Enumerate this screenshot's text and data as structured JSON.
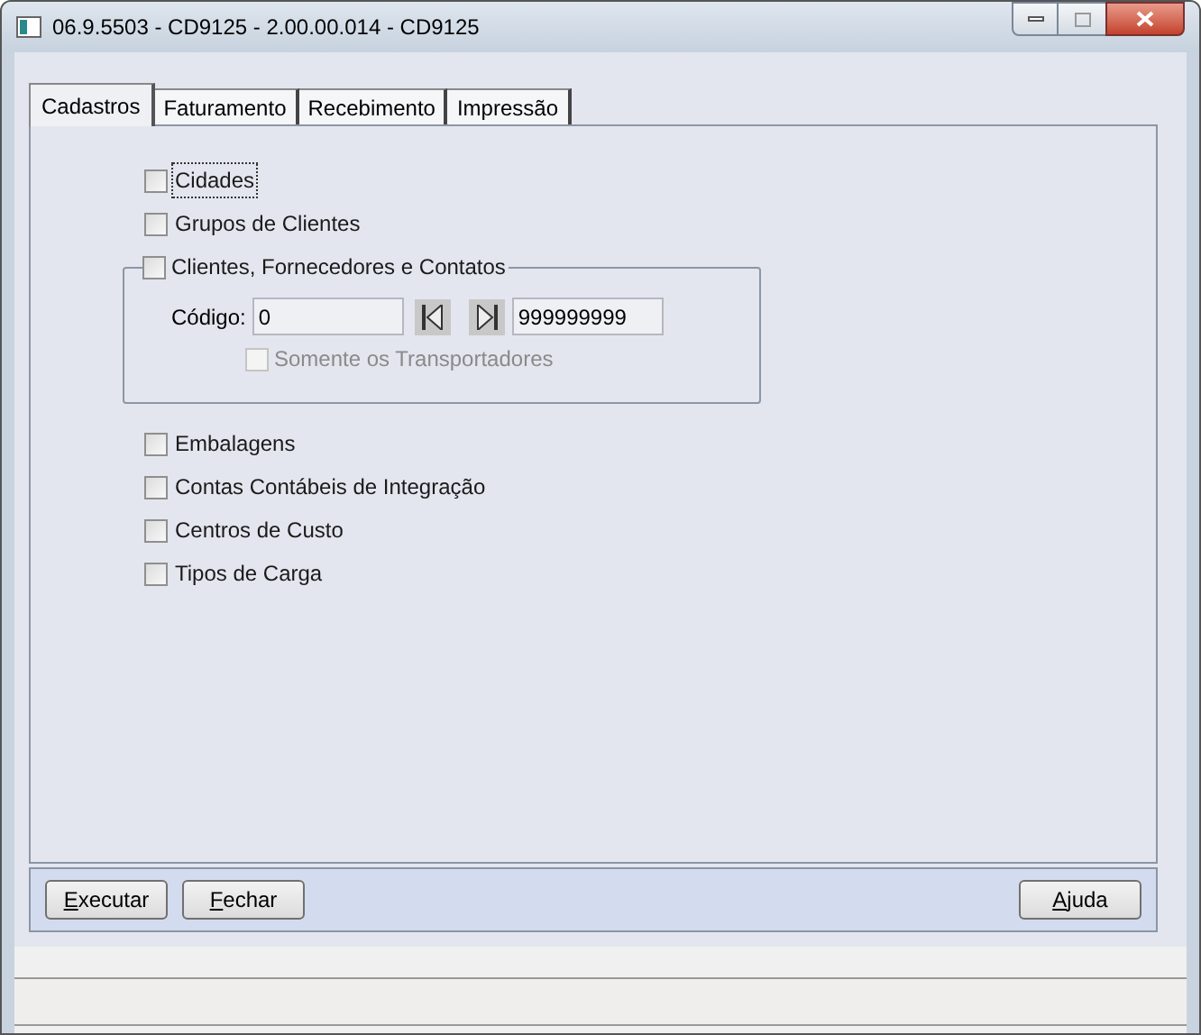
{
  "window": {
    "title": "06.9.5503 - CD9125 - 2.00.00.014 - CD9125"
  },
  "tabs": [
    {
      "label": "Cadastros",
      "selected": true
    },
    {
      "label": "Faturamento",
      "selected": false
    },
    {
      "label": "Recebimento",
      "selected": false
    },
    {
      "label": "Impressão",
      "selected": false
    }
  ],
  "options_top": [
    {
      "label": "Cidades",
      "checked": false,
      "focused": true
    },
    {
      "label": "Grupos de Clientes",
      "checked": false,
      "focused": false
    }
  ],
  "group": {
    "label": "Clientes, Fornecedores e Contatos",
    "checked": false,
    "code_label": "Código:",
    "code_from": "0",
    "code_to": "999999999",
    "sub_option": {
      "label": "Somente os Transportadores",
      "checked": false,
      "disabled": true
    }
  },
  "options_bottom": [
    {
      "label": "Embalagens",
      "checked": false,
      "focused": false
    },
    {
      "label": "Contas Contábeis de Integração",
      "checked": false,
      "focused": false
    },
    {
      "label": "Centros de Custo",
      "checked": false,
      "focused": false
    },
    {
      "label": "Tipos de Carga",
      "checked": false,
      "focused": false
    }
  ],
  "left_buttons": [
    "Executar",
    "Fechar"
  ],
  "right_buttons": [
    "Ajuda"
  ]
}
